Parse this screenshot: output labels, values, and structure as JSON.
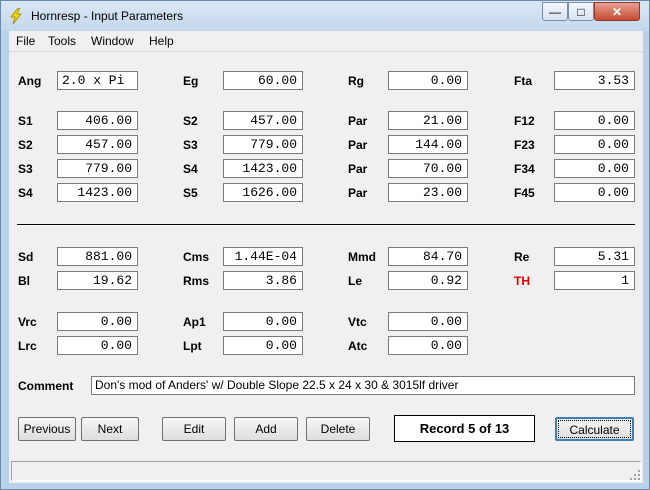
{
  "window": {
    "title": "Hornresp - Input Parameters"
  },
  "menu": [
    "File",
    "Tools",
    "Window",
    "Help"
  ],
  "rows_top": [
    {
      "c1": {
        "label": "Ang",
        "value": "2.0 x Pi"
      },
      "c2": {
        "label": "Eg",
        "value": "60.00"
      },
      "c3": {
        "label": "Rg",
        "value": "0.00"
      },
      "c4": {
        "label": "Fta",
        "value": "3.53"
      }
    }
  ],
  "segments": [
    {
      "c1": {
        "label": "S1",
        "value": "406.00"
      },
      "c2": {
        "label": "S2",
        "value": "457.00"
      },
      "c3": {
        "label": "Par",
        "value": "21.00"
      },
      "c4": {
        "label": "F12",
        "value": "0.00"
      }
    },
    {
      "c1": {
        "label": "S2",
        "value": "457.00"
      },
      "c2": {
        "label": "S3",
        "value": "779.00"
      },
      "c3": {
        "label": "Par",
        "value": "144.00"
      },
      "c4": {
        "label": "F23",
        "value": "0.00"
      }
    },
    {
      "c1": {
        "label": "S3",
        "value": "779.00"
      },
      "c2": {
        "label": "S4",
        "value": "1423.00"
      },
      "c3": {
        "label": "Par",
        "value": "70.00"
      },
      "c4": {
        "label": "F34",
        "value": "0.00"
      }
    },
    {
      "c1": {
        "label": "S4",
        "value": "1423.00"
      },
      "c2": {
        "label": "S5",
        "value": "1626.00"
      },
      "c3": {
        "label": "Par",
        "value": "23.00"
      },
      "c4": {
        "label": "F45",
        "value": "0.00"
      }
    }
  ],
  "driver": [
    {
      "c1": {
        "label": "Sd",
        "value": "881.00"
      },
      "c2": {
        "label": "Cms",
        "value": "1.44E-04"
      },
      "c3": {
        "label": "Mmd",
        "value": "84.70"
      },
      "c4": {
        "label": "Re",
        "value": "5.31"
      }
    },
    {
      "c1": {
        "label": "Bl",
        "value": "19.62"
      },
      "c2": {
        "label": "Rms",
        "value": "3.86"
      },
      "c3": {
        "label": "Le",
        "value": "0.92"
      },
      "c4": {
        "label": "TH",
        "value": "1"
      }
    }
  ],
  "chambers": [
    {
      "c1": {
        "label": "Vrc",
        "value": "0.00"
      },
      "c2": {
        "label": "Ap1",
        "value": "0.00"
      },
      "c3": {
        "label": "Vtc",
        "value": "0.00"
      }
    },
    {
      "c1": {
        "label": "Lrc",
        "value": "0.00"
      },
      "c2": {
        "label": "Lpt",
        "value": "0.00"
      },
      "c3": {
        "label": "Atc",
        "value": "0.00"
      }
    }
  ],
  "comment": {
    "label": "Comment",
    "value": "Don's mod of Anders' w/ Double Slope 22.5 x 24 x 30 & 3015lf driver"
  },
  "buttons": {
    "previous": "Previous",
    "next": "Next",
    "edit": "Edit",
    "add": "Add",
    "delete": "Delete",
    "record": "Record 5 of 13",
    "calculate": "Calculate"
  },
  "colors": {
    "th_label": "#e00000",
    "titlebar": "#c3d7ec"
  }
}
